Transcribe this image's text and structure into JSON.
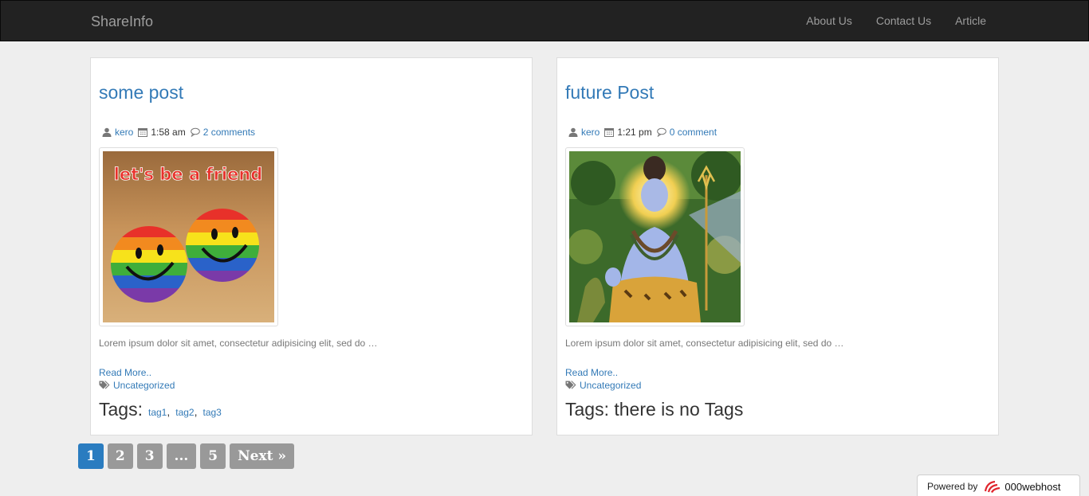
{
  "navbar": {
    "brand": "ShareInfo",
    "links": [
      "About Us",
      "Contact Us",
      "Article"
    ]
  },
  "posts": [
    {
      "title": "some post",
      "author": "kero",
      "time": "1:58 am",
      "comments": "2 comments",
      "image_text": "let's be a friend",
      "excerpt": "Lorem ipsum dolor sit amet, consectetur adipisicing elit, sed do …",
      "read_more": "Read More..",
      "category": "Uncategorized",
      "tags_label": "Tags:",
      "tags": [
        "tag1",
        "tag2",
        "tag3"
      ]
    },
    {
      "title": "future Post",
      "author": "kero",
      "time": "1:21 pm",
      "comments": "0 comment",
      "excerpt": "Lorem ipsum dolor sit amet, consectetur adipisicing elit, sed do …",
      "read_more": "Read More..",
      "category": "Uncategorized",
      "tags_text": "Tags: there is no Tags"
    }
  ],
  "pagination": {
    "pages": [
      "1",
      "2",
      "3",
      "...",
      "5"
    ],
    "active": "1",
    "next": "Next »"
  },
  "footer": {
    "powered_by": "Powered by",
    "host_name": "000webhost"
  },
  "colors": {
    "navbar_bg": "#222222",
    "link": "#337ab7",
    "page_active": "#2a7cc0",
    "page_default": "#999999"
  }
}
